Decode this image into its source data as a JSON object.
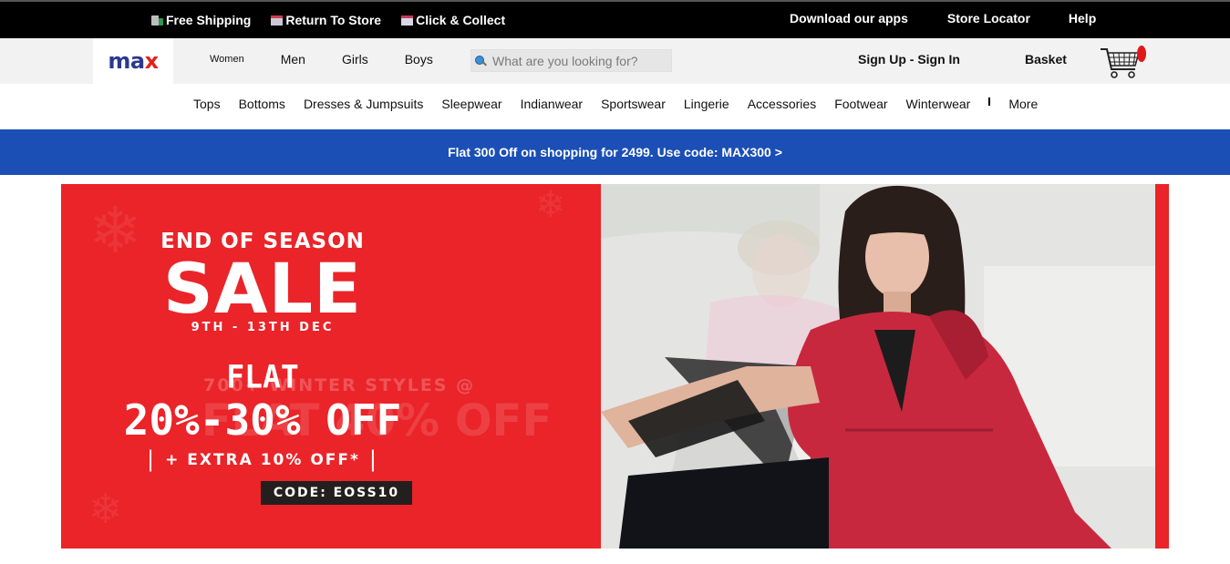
{
  "topbar": {
    "left_links": [
      {
        "label": "Free Shipping",
        "icon": "truck-icon"
      },
      {
        "label": "Return To Store",
        "icon": "store-icon"
      },
      {
        "label": "Click & Collect",
        "icon": "collect-icon"
      }
    ],
    "right_links": [
      {
        "label": "Download our apps"
      },
      {
        "label": "Store Locator"
      },
      {
        "label": "Help"
      }
    ]
  },
  "header": {
    "logo_text": "max",
    "categories": [
      "Women",
      "Men",
      "Girls",
      "Boys"
    ],
    "search": {
      "placeholder": "What are you looking for?",
      "value": ""
    },
    "account_label": "Sign Up - Sign In",
    "basket_label": "Basket"
  },
  "subnav": {
    "items": [
      "Tops",
      "Bottoms",
      "Dresses & Jumpsuits",
      "Sleepwear",
      "Indianwear",
      "Sportswear",
      "Lingerie",
      "Accessories",
      "Footwear",
      "Winterwear"
    ],
    "more_label": "More"
  },
  "promo": {
    "text": "Flat 300 Off on shopping for 2499. Use code: MAX300 >"
  },
  "hero": {
    "line1": "END OF SEASON",
    "line2": "SALE",
    "dates": "9TH - 13TH DEC",
    "ghost_text": "700+ WINTER STYLES @",
    "ghost_text2": "FLAT 40% OFF",
    "flat": "FLAT",
    "discount": "20%-30% OFF",
    "extra": "+ EXTRA 10% OFF*",
    "code": "CODE: EOSS10",
    "colors": {
      "red": "#ea2429",
      "promo_blue": "#1b4fb5",
      "code_bg": "#231f1f"
    }
  }
}
